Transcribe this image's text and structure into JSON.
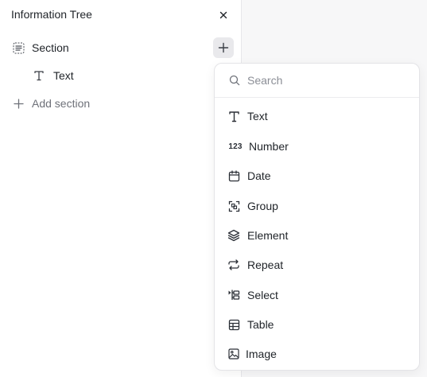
{
  "panel": {
    "title": "Information Tree",
    "close_icon": "close-icon"
  },
  "tree": {
    "section_label": "Section",
    "section_icon": "section-icon",
    "text_label": "Text",
    "text_icon": "text-icon",
    "add_section_label": "Add section",
    "add_icon": "plus-icon"
  },
  "dropdown": {
    "search_placeholder": "Search",
    "items": [
      {
        "label": "Text",
        "icon": "text-icon"
      },
      {
        "label": "Number",
        "icon": "number-icon",
        "glyph": "123"
      },
      {
        "label": "Date",
        "icon": "calendar-icon"
      },
      {
        "label": "Group",
        "icon": "group-icon"
      },
      {
        "label": "Element",
        "icon": "layers-icon"
      },
      {
        "label": "Repeat",
        "icon": "repeat-icon"
      },
      {
        "label": "Select",
        "icon": "select-icon"
      },
      {
        "label": "Table",
        "icon": "table-icon"
      },
      {
        "label": "Image",
        "icon": "image-icon"
      }
    ]
  },
  "colors": {
    "panel_bg": "#ffffff",
    "page_bg": "#f7f7f8",
    "muted_text": "#6e7179",
    "add_button_bg": "#e9e9ec"
  }
}
